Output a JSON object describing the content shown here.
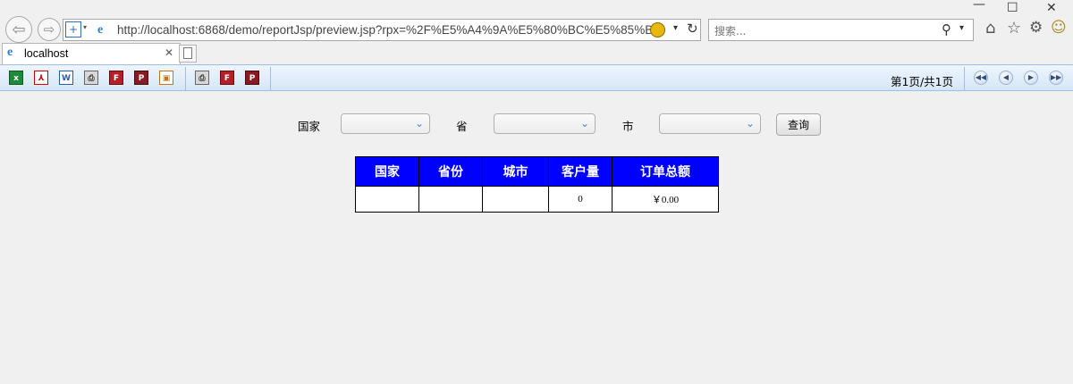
{
  "browser": {
    "url": "http://localhost:6868/demo/reportJsp/preview.jsp?rpx=%2F%E5%A4%9A%E5%80%BC%E5%85%B3%E",
    "search_placeholder": "搜索...",
    "tab_title": "localhost"
  },
  "toolbar": {
    "page_info": "第1页/共1页"
  },
  "query": {
    "country_label": "国家",
    "province_label": "省",
    "city_label": "市",
    "country_value": "",
    "province_value": "",
    "city_value": "",
    "query_button": "查询"
  },
  "report": {
    "headers": [
      "国家",
      "省份",
      "城市",
      "客户量",
      "订单总额"
    ],
    "row": [
      "",
      "",
      "",
      "0",
      "￥0.00"
    ]
  },
  "colors": {
    "header_bg": "#0000ff",
    "toolbar_border": "#9ebee6"
  }
}
